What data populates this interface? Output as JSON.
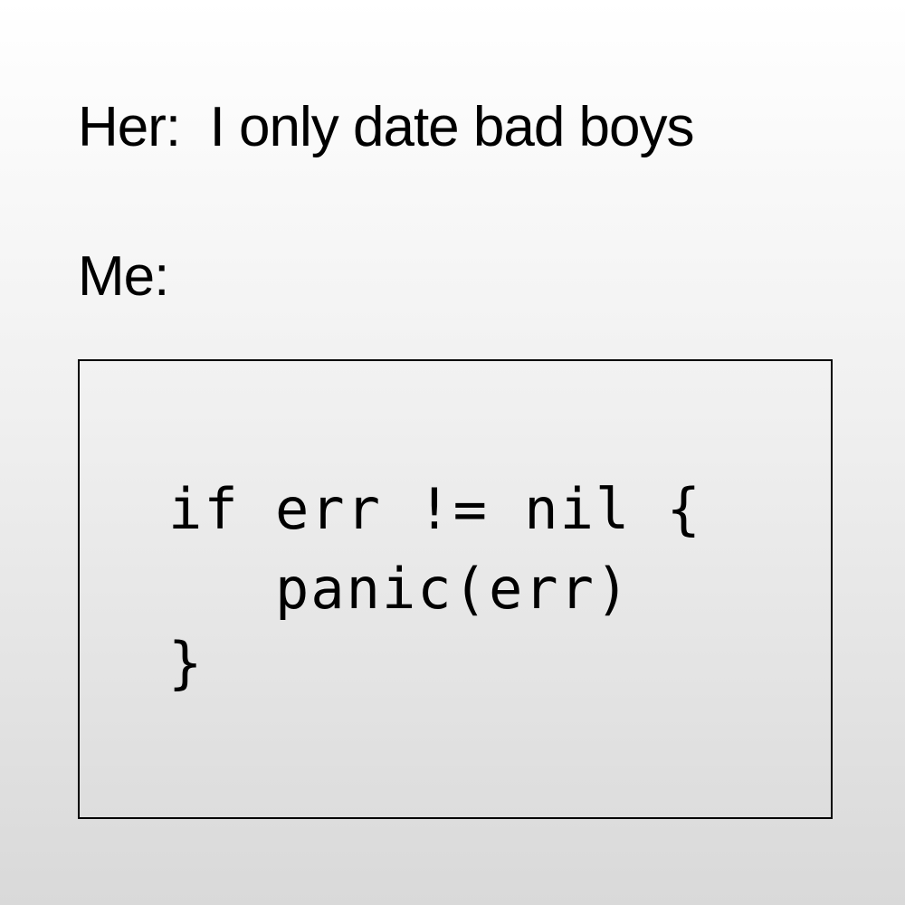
{
  "meme": {
    "her_line": "Her:  I only date bad boys",
    "me_line": "Me:",
    "code_lines": [
      "if err != nil {",
      "   panic(err)",
      "}"
    ]
  }
}
